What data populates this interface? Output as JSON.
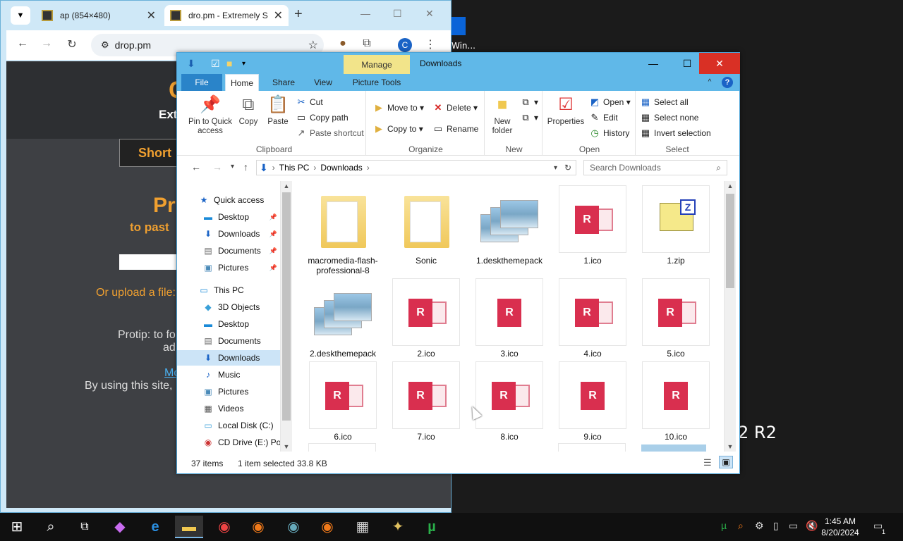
{
  "desktop": {
    "label_win": "Win...",
    "label_r2": "2 R2"
  },
  "chrome": {
    "tabs": [
      {
        "title": "ap (854×480)"
      },
      {
        "title": "dro.pm - Extremely S"
      }
    ],
    "new_tab": "+",
    "url": "drop.pm",
    "profile_initial": "C",
    "page": {
      "headline_fragment": "C",
      "sub_fragment": "Ext",
      "short_button": "Short",
      "promo_fragment": "Pr",
      "promo_sub_fragment": "to past",
      "upload_fragment": "Or upload a file:",
      "protip_fragment": "Protip: to fo",
      "protip_fragment2": "ad",
      "more_link_fragment": "Mo",
      "terms_fragment": "By using this site,"
    }
  },
  "explorer": {
    "title": "Downloads",
    "context_tab": "Manage",
    "window_controls": {
      "minimize": "—",
      "maximize": "☐",
      "close": "✕"
    },
    "tabs": {
      "file": "File",
      "home": "Home",
      "share": "Share",
      "view": "View",
      "picture_tools": "Picture Tools"
    },
    "ribbon": {
      "clipboard": {
        "label": "Clipboard",
        "pin": "Pin to Quick access",
        "copy": "Copy",
        "paste": "Paste",
        "cut": "Cut",
        "copy_path": "Copy path",
        "paste_shortcut": "Paste shortcut"
      },
      "organize": {
        "label": "Organize",
        "move_to": "Move to",
        "copy_to": "Copy to",
        "delete": "Delete",
        "rename": "Rename"
      },
      "new": {
        "label": "New",
        "new_folder": "New folder"
      },
      "open": {
        "label": "Open",
        "properties": "Properties",
        "open": "Open",
        "edit": "Edit",
        "history": "History"
      },
      "select": {
        "label": "Select",
        "select_all": "Select all",
        "select_none": "Select none",
        "invert": "Invert selection"
      }
    },
    "address": {
      "this_pc": "This PC",
      "downloads": "Downloads",
      "search_placeholder": "Search Downloads"
    },
    "nav": {
      "quick_access": "Quick access",
      "qa_desktop": "Desktop",
      "qa_downloads": "Downloads",
      "qa_documents": "Documents",
      "qa_pictures": "Pictures",
      "this_pc": "This PC",
      "objects3d": "3D Objects",
      "desktop": "Desktop",
      "documents": "Documents",
      "downloads": "Downloads",
      "music": "Music",
      "pictures": "Pictures",
      "videos": "Videos",
      "local_disk": "Local Disk (C:)",
      "cd_drive": "CD Drive (E:) Por"
    },
    "files": [
      {
        "name": "macromedia-flash-professional-8",
        "kind": "folder"
      },
      {
        "name": "Sonic",
        "kind": "folder"
      },
      {
        "name": "1.deskthemepack",
        "kind": "theme"
      },
      {
        "name": "1.ico",
        "kind": "ico"
      },
      {
        "name": "1.zip",
        "kind": "zip"
      },
      {
        "name": "2.deskthemepack",
        "kind": "theme"
      },
      {
        "name": "2.ico",
        "kind": "ico"
      },
      {
        "name": "3.ico",
        "kind": "ico-r"
      },
      {
        "name": "4.ico",
        "kind": "ico"
      },
      {
        "name": "5.ico",
        "kind": "ico"
      },
      {
        "name": "6.ico",
        "kind": "ico"
      },
      {
        "name": "7.ico",
        "kind": "ico"
      },
      {
        "name": "8.ico",
        "kind": "ico"
      },
      {
        "name": "9.ico",
        "kind": "ico-r"
      },
      {
        "name": "10.ico",
        "kind": "ico-r"
      }
    ],
    "status": {
      "items": "37 items",
      "selected": "1 item selected",
      "size": "33.8 KB"
    }
  },
  "taskbar": {
    "time": "1:45 AM",
    "date": "8/20/2024",
    "notification_count": "1"
  }
}
